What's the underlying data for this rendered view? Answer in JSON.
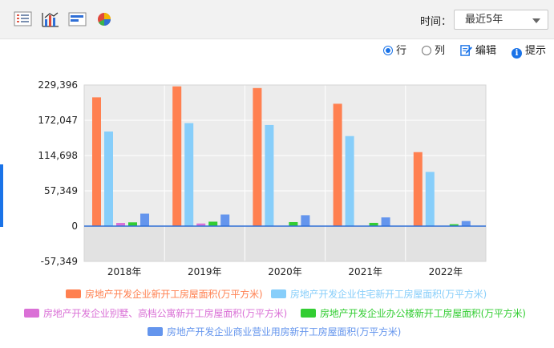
{
  "toolbar": {
    "icons": [
      "table-icon",
      "bar-chart-icon",
      "horizontal-bar-icon",
      "pie-chart-icon"
    ],
    "time_label": "时间：",
    "time_value": "最近5年"
  },
  "options": {
    "row_label": "行",
    "col_label": "列",
    "edit_label": "编辑",
    "hint_label": "提示",
    "selected": "行"
  },
  "chart_data": {
    "type": "bar",
    "categories": [
      "2018年",
      "2019年",
      "2020年",
      "2021年",
      "2022年"
    ],
    "y_ticks": [
      "229,396",
      "172,047",
      "114,698",
      "57,349",
      "0",
      "-57,349"
    ],
    "ylim": [
      -57349,
      229396
    ],
    "grid": true,
    "legend_position": "bottom",
    "series": [
      {
        "name": "房地产开发企业新开工房屋面积(万平方米)",
        "color": "#ff8050",
        "values": [
          209342,
          227154,
          224433,
          198895,
          120262
        ]
      },
      {
        "name": "房地产开发企业住宅新开工房屋面积(万平方米)",
        "color": "#87cefa",
        "values": [
          153753,
          167463,
          164329,
          146379,
          88135
        ]
      },
      {
        "name": "房地产开发企业别墅、高档公寓新开工房屋面积(万平方米)",
        "color": "#da70d6",
        "values": [
          5180,
          4290,
          0,
          0,
          0
        ]
      },
      {
        "name": "房地产开发企业办公楼新开工房屋面积(万平方米)",
        "color": "#32cd32",
        "values": [
          6143,
          7235,
          6553,
          5295,
          3102
        ]
      },
      {
        "name": "房地产开发企业商业营业用房新开工房屋面积(万平方米)",
        "color": "#6495ed",
        "values": [
          20233,
          18885,
          17722,
          14153,
          8239
        ]
      }
    ]
  }
}
